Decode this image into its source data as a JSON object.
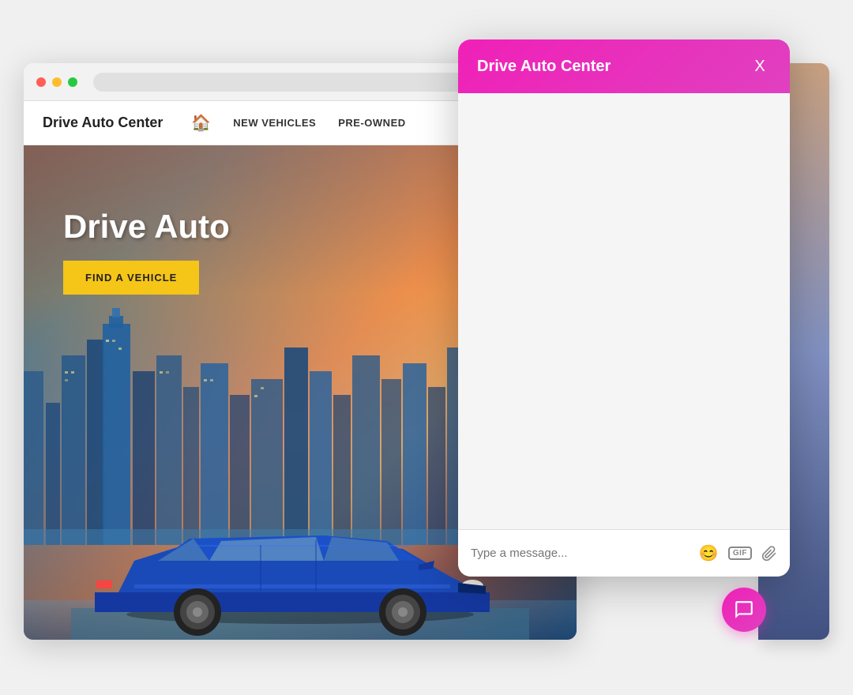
{
  "browser": {
    "dots": [
      "red",
      "yellow",
      "green"
    ],
    "address_placeholder": ""
  },
  "website": {
    "logo": "Drive Auto Center",
    "nav": {
      "home_icon": "🏠",
      "links": [
        "NEW VEHICLES",
        "PRE-OWNED"
      ]
    },
    "hero": {
      "title": "Drive Auto",
      "cta_button": "FIND A VEHICLE"
    }
  },
  "chat": {
    "title": "Drive Auto Center",
    "close_label": "X",
    "input_placeholder": "Type a message...",
    "gif_label": "GIF",
    "emoji_icon": "😊",
    "attach_icon": "📎"
  },
  "chat_fab": {
    "icon": "💬"
  }
}
